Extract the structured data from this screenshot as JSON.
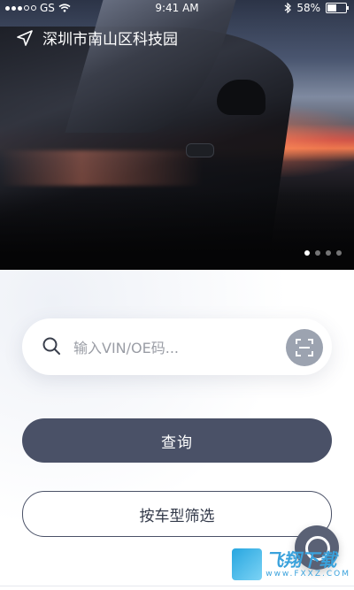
{
  "status_bar": {
    "carrier": "GS",
    "time": "9:41 AM",
    "battery": "58%",
    "battery_level": 0.58
  },
  "header": {
    "location": "深圳市南山区科技园"
  },
  "carousel": {
    "count": 4,
    "active_index": 0
  },
  "search": {
    "placeholder": "输入VIN/OE码..."
  },
  "actions": {
    "query_label": "查询",
    "filter_by_model_label": "按车型筛选"
  },
  "watermark": {
    "title": "飞翔下载",
    "subtitle": "www.FXXZ.COM"
  },
  "colors": {
    "primary": "#4a5167",
    "scan_button": "#9ca3b0",
    "watermark": "#3aa2dc"
  },
  "icons": [
    "signal-dots-icon",
    "wifi-icon",
    "bluetooth-icon",
    "battery-icon",
    "location-arrow-icon",
    "search-icon",
    "scan-icon"
  ]
}
